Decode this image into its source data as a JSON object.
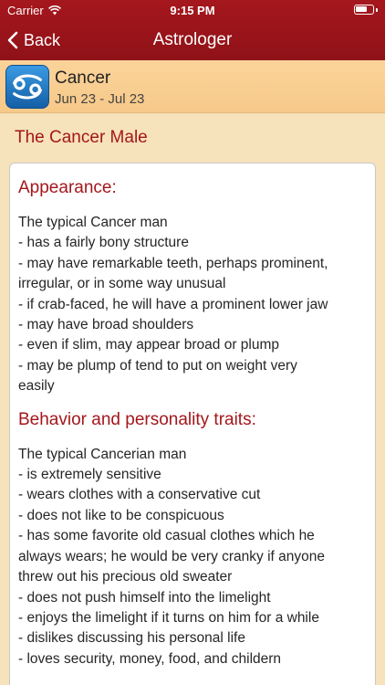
{
  "status_bar": {
    "carrier": "Carrier",
    "time": "9:15 PM",
    "battery_level": 0.7
  },
  "nav": {
    "back_label": "Back",
    "title": "Astrologer"
  },
  "sign": {
    "name": "Cancer",
    "dates": "Jun 23 - Jul 23",
    "icon": "cancer-zodiac-icon"
  },
  "section_title": "The Cancer Male",
  "content": {
    "appearance": {
      "heading": "Appearance:",
      "lines": [
        "The typical Cancer man",
        "- has a fairly bony structure",
        "- may have remarkable teeth, perhaps prominent,",
        "irregular, or in some way unusual",
        "- if crab-faced, he will have a prominent lower jaw",
        "- may have broad shoulders",
        "- even if slim, may appear broad or plump",
        "- may be plump of tend to put on weight very",
        "easily"
      ]
    },
    "behavior": {
      "heading": "Behavior and personality traits:",
      "lines": [
        "The typical Cancerian man",
        "- is extremely sensitive",
        "- wears clothes with a conservative cut",
        "- does not like to be conspicuous",
        "- has some favorite old casual clothes which he",
        "always wears; he would be very cranky if anyone",
        "threw out his precious old sweater",
        "- does not push himself into the limelight",
        "- enjoys the limelight if it turns on him for a while",
        "- dislikes discussing his personal life",
        "- loves security, money, food, and childern"
      ]
    }
  },
  "colors": {
    "nav_bar": "#9e161c",
    "accent_text": "#a3171c",
    "background": "#f6e2bb",
    "sign_header": "#f9cf93",
    "icon_tile": "#1f7cc7"
  }
}
